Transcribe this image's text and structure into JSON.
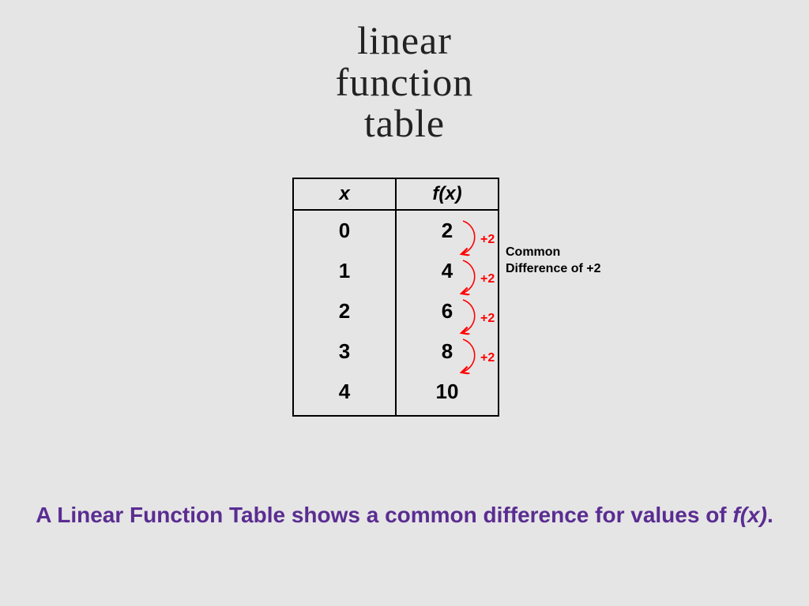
{
  "title": "linear\nfunction\ntable",
  "table": {
    "headers": {
      "x": "x",
      "fx": "f(x)"
    },
    "rows": [
      {
        "x": "0",
        "fx": "2"
      },
      {
        "x": "1",
        "fx": "4"
      },
      {
        "x": "2",
        "fx": "6"
      },
      {
        "x": "3",
        "fx": "8"
      },
      {
        "x": "4",
        "fx": "10"
      }
    ]
  },
  "differences": [
    "+2",
    "+2",
    "+2",
    "+2"
  ],
  "common_label": "Common\nDifference of +2",
  "caption": {
    "pre": "A Linear Function Table shows a common difference for values of ",
    "fx": "f(x)",
    "post": "."
  },
  "colors": {
    "accent": "#f00",
    "caption": "#5a2d91"
  },
  "chart_data": {
    "type": "table",
    "title": "linear function table",
    "columns": [
      "x",
      "f(x)"
    ],
    "rows": [
      [
        0,
        2
      ],
      [
        1,
        4
      ],
      [
        2,
        6
      ],
      [
        3,
        8
      ],
      [
        4,
        10
      ]
    ],
    "common_difference": 2
  }
}
